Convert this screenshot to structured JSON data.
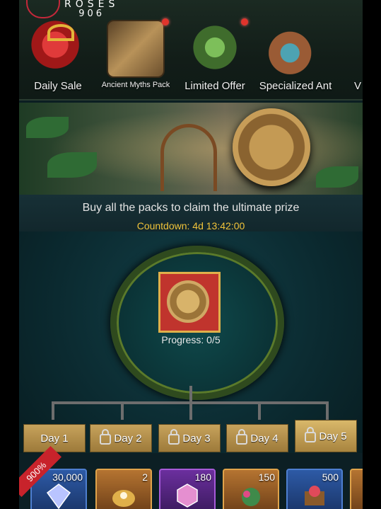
{
  "watermark": {
    "line1": "ROSES",
    "line2": "906"
  },
  "tabs": [
    {
      "label": "Daily Sale",
      "badge": false,
      "icon": "gift-icon"
    },
    {
      "label": "Ancient Myths Pack",
      "badge": true,
      "icon": "lyre-icon"
    },
    {
      "label": "Limited Offer",
      "badge": true,
      "icon": "plant-icon"
    },
    {
      "label": "Specialized Ant",
      "badge": false,
      "icon": "ant-icon"
    },
    {
      "label": "V",
      "badge": false,
      "icon": "partial-tab-icon"
    }
  ],
  "info": {
    "headline": "Buy all the packs to claim the ultimate prize",
    "countdown": "Countdown: 4d 13:42:00"
  },
  "reward": {
    "progress": "Progress: 0/5"
  },
  "days": [
    {
      "label": "Day 1",
      "locked": false
    },
    {
      "label": "Day 2",
      "locked": true
    },
    {
      "label": "Day 3",
      "locked": true
    },
    {
      "label": "Day 4",
      "locked": true
    },
    {
      "label": "Day 5",
      "locked": true
    }
  ],
  "promo": {
    "ribbon": "900%"
  },
  "items": [
    {
      "count": "30,000",
      "icon": "diamond-icon"
    },
    {
      "count": "2",
      "icon": "shell-icon"
    },
    {
      "count": "180",
      "icon": "gem-icon"
    },
    {
      "count": "150",
      "icon": "plant-icon"
    },
    {
      "count": "500",
      "icon": "chest-icon"
    }
  ],
  "colors": {
    "accent_gold": "#f0c33a",
    "badge_red": "#e0342c",
    "day_tab": "#c7a35c"
  }
}
